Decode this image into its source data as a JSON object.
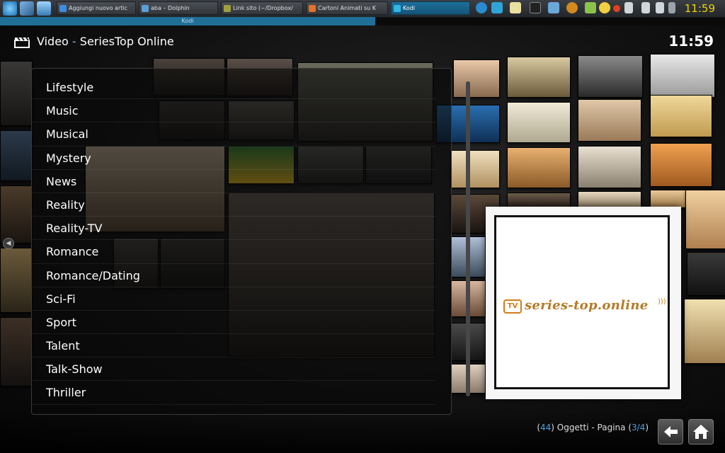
{
  "taskbar": {
    "tasks": [
      {
        "label": "Aggiungi nuovo artic"
      },
      {
        "label": "aba – Dolphin"
      },
      {
        "label": "Link sito (~/Dropbox/"
      },
      {
        "label": "Cartoni Animati su K"
      },
      {
        "label": "Kodi"
      }
    ],
    "clock": "11:59"
  },
  "window": {
    "title": "Kodi"
  },
  "header": {
    "section": "Video",
    "separator": " - ",
    "addon": "SeriesTop Online",
    "clock": "11:59"
  },
  "genres": [
    {
      "label": "Lifestyle"
    },
    {
      "label": "Music"
    },
    {
      "label": "Musical"
    },
    {
      "label": "Mystery"
    },
    {
      "label": "News"
    },
    {
      "label": "Reality"
    },
    {
      "label": "Reality-TV"
    },
    {
      "label": "Romance"
    },
    {
      "label": "Romance/Dating"
    },
    {
      "label": "Sci-Fi"
    },
    {
      "label": "Sport"
    },
    {
      "label": "Talent"
    },
    {
      "label": "Talk-Show"
    },
    {
      "label": "Thriller"
    }
  ],
  "poster": {
    "logo_tv": "TV",
    "logo_text": "series-top.online"
  },
  "footer": {
    "open_paren": "(",
    "count": "44",
    "objects_label": ") Oggetti - Pagina (",
    "page": "3/4",
    "close_paren": ")"
  },
  "colors": {
    "accent": "#4aa3e3",
    "taskbar_clock": "#f2d400",
    "logo_orange": "#d27b16"
  },
  "icons": {
    "header": "film-clapper-icon",
    "back": "back-arrow-icon",
    "home": "home-icon"
  }
}
